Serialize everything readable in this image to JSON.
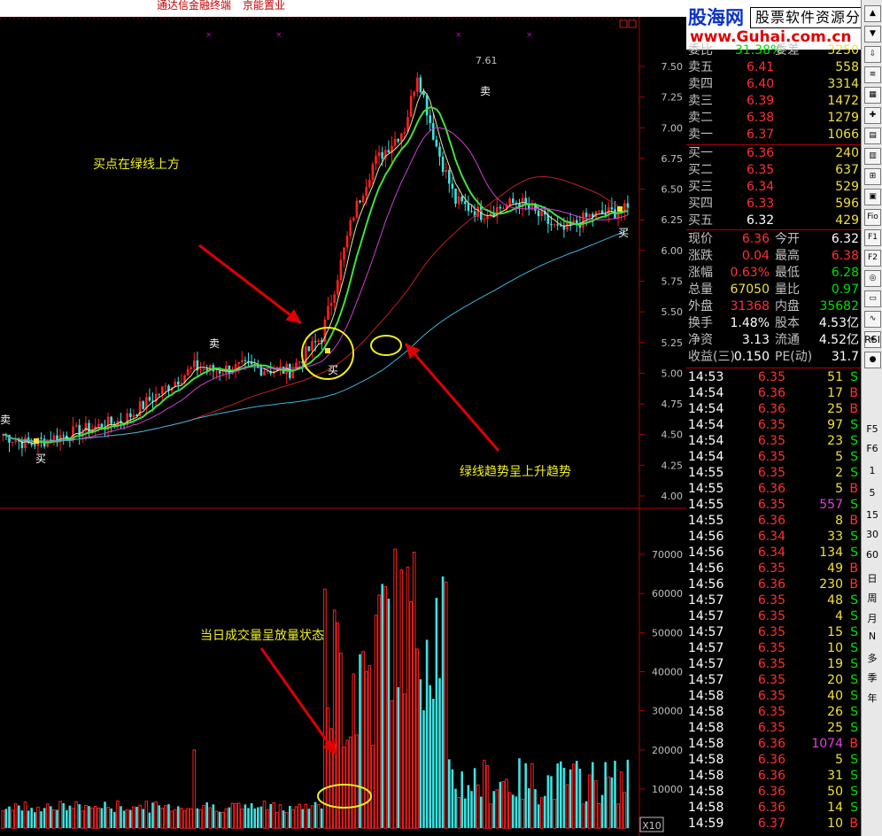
{
  "title_bar": {
    "app": "通达信金融终端",
    "stock": "京能置业"
  },
  "annotations": {
    "buy_point": "买点在绿线上方",
    "green_trend": "绿线趋势呈上升趋势",
    "volume_state": "当日成交量呈放量状态",
    "peak": "7.61"
  },
  "signals": {
    "buy": "买",
    "sell": "卖"
  },
  "price_axis": [
    "7.50",
    "7.25",
    "7.00",
    "6.75",
    "6.50",
    "6.25",
    "6.00",
    "5.75",
    "5.50",
    "5.25",
    "5.00",
    "4.75",
    "4.50",
    "4.25",
    "4.00"
  ],
  "volume_axis": [
    "70000",
    "60000",
    "50000",
    "40000",
    "30000",
    "20000",
    "10000"
  ],
  "volume_unit": "X10",
  "logo": {
    "name": "股海网",
    "tagline": "股票软件资源分享",
    "url": "www.Guhai.com.cn"
  },
  "order_book": {
    "header": {
      "label1": "委比",
      "value1": "31.38%",
      "label2": "委差",
      "value2": "3250"
    },
    "asks": [
      {
        "label": "卖五",
        "price": "6.41",
        "vol": "558"
      },
      {
        "label": "卖四",
        "price": "6.40",
        "vol": "3314"
      },
      {
        "label": "卖三",
        "price": "6.39",
        "vol": "1472"
      },
      {
        "label": "卖二",
        "price": "6.38",
        "vol": "1279"
      },
      {
        "label": "卖一",
        "price": "6.37",
        "vol": "1066"
      }
    ],
    "bids": [
      {
        "label": "买一",
        "price": "6.36",
        "vol": "240"
      },
      {
        "label": "买二",
        "price": "6.35",
        "vol": "637"
      },
      {
        "label": "买三",
        "price": "6.34",
        "vol": "529"
      },
      {
        "label": "买四",
        "price": "6.33",
        "vol": "596"
      },
      {
        "label": "买五",
        "price": "6.32",
        "vol": "429"
      }
    ]
  },
  "stats": [
    {
      "l1": "现价",
      "v1": "6.36",
      "l2": "今开",
      "v2": "6.32"
    },
    {
      "l1": "涨跌",
      "v1": "0.04",
      "l2": "最高",
      "v2": "6.38"
    },
    {
      "l1": "涨幅",
      "v1": "0.63%",
      "l2": "最低",
      "v2": "6.28"
    },
    {
      "l1": "总量",
      "v1": "67050",
      "l2": "量比",
      "v2": "0.97"
    },
    {
      "l1": "外盘",
      "v1": "31368",
      "l2": "内盘",
      "v2": "35682"
    },
    {
      "l1": "换手",
      "v1": "1.48%",
      "l2": "股本",
      "v2": "4.53亿"
    },
    {
      "l1": "净资",
      "v1": "3.13",
      "l2": "流通",
      "v2": "4.52亿"
    },
    {
      "l1": "收益(三)",
      "v1": "0.150",
      "l2": "PE(动)",
      "v2": "31.7"
    }
  ],
  "ticks": [
    [
      "14:53",
      "6.35",
      "51",
      "S"
    ],
    [
      "14:54",
      "6.36",
      "17",
      "B"
    ],
    [
      "14:54",
      "6.36",
      "25",
      "B"
    ],
    [
      "14:54",
      "6.35",
      "97",
      "S"
    ],
    [
      "14:54",
      "6.35",
      "23",
      "S"
    ],
    [
      "14:54",
      "6.35",
      "5",
      "S"
    ],
    [
      "14:55",
      "6.35",
      "2",
      "S"
    ],
    [
      "14:55",
      "6.36",
      "5",
      "B"
    ],
    [
      "14:55",
      "6.35",
      "557",
      "S"
    ],
    [
      "14:55",
      "6.36",
      "8",
      "B"
    ],
    [
      "14:56",
      "6.34",
      "33",
      "S"
    ],
    [
      "14:56",
      "6.34",
      "134",
      "S"
    ],
    [
      "14:56",
      "6.35",
      "49",
      "B"
    ],
    [
      "14:56",
      "6.36",
      "230",
      "B"
    ],
    [
      "14:57",
      "6.35",
      "48",
      "S"
    ],
    [
      "14:57",
      "6.35",
      "4",
      "S"
    ],
    [
      "14:57",
      "6.35",
      "15",
      "S"
    ],
    [
      "14:57",
      "6.35",
      "10",
      "S"
    ],
    [
      "14:57",
      "6.35",
      "19",
      "S"
    ],
    [
      "14:57",
      "6.35",
      "20",
      "S"
    ],
    [
      "14:58",
      "6.35",
      "40",
      "S"
    ],
    [
      "14:58",
      "6.35",
      "26",
      "S"
    ],
    [
      "14:58",
      "6.35",
      "25",
      "S"
    ],
    [
      "14:58",
      "6.36",
      "1074",
      "B"
    ],
    [
      "14:58",
      "6.36",
      "5",
      "S"
    ],
    [
      "14:58",
      "6.36",
      "31",
      "S"
    ],
    [
      "14:58",
      "6.36",
      "50",
      "S"
    ],
    [
      "14:58",
      "6.36",
      "14",
      "S"
    ],
    [
      "14:59",
      "6.37",
      "10",
      "B"
    ]
  ],
  "toolbar_labels": [
    "RSI",
    "F5",
    "F6",
    "1",
    "5",
    "15",
    "30",
    "60",
    "日",
    "周",
    "月",
    "N",
    "多",
    "季",
    "年"
  ],
  "colors": {
    "up": "#ff2020",
    "down": "#40e0e0",
    "ma_white": "#e6e6a0",
    "ma_green": "#40e040",
    "ma_purple": "#d040d0",
    "ma_red": "#c02020",
    "ma_cyan": "#3cb4dc",
    "annotation": "#f0f020",
    "grid": "#800000"
  }
}
